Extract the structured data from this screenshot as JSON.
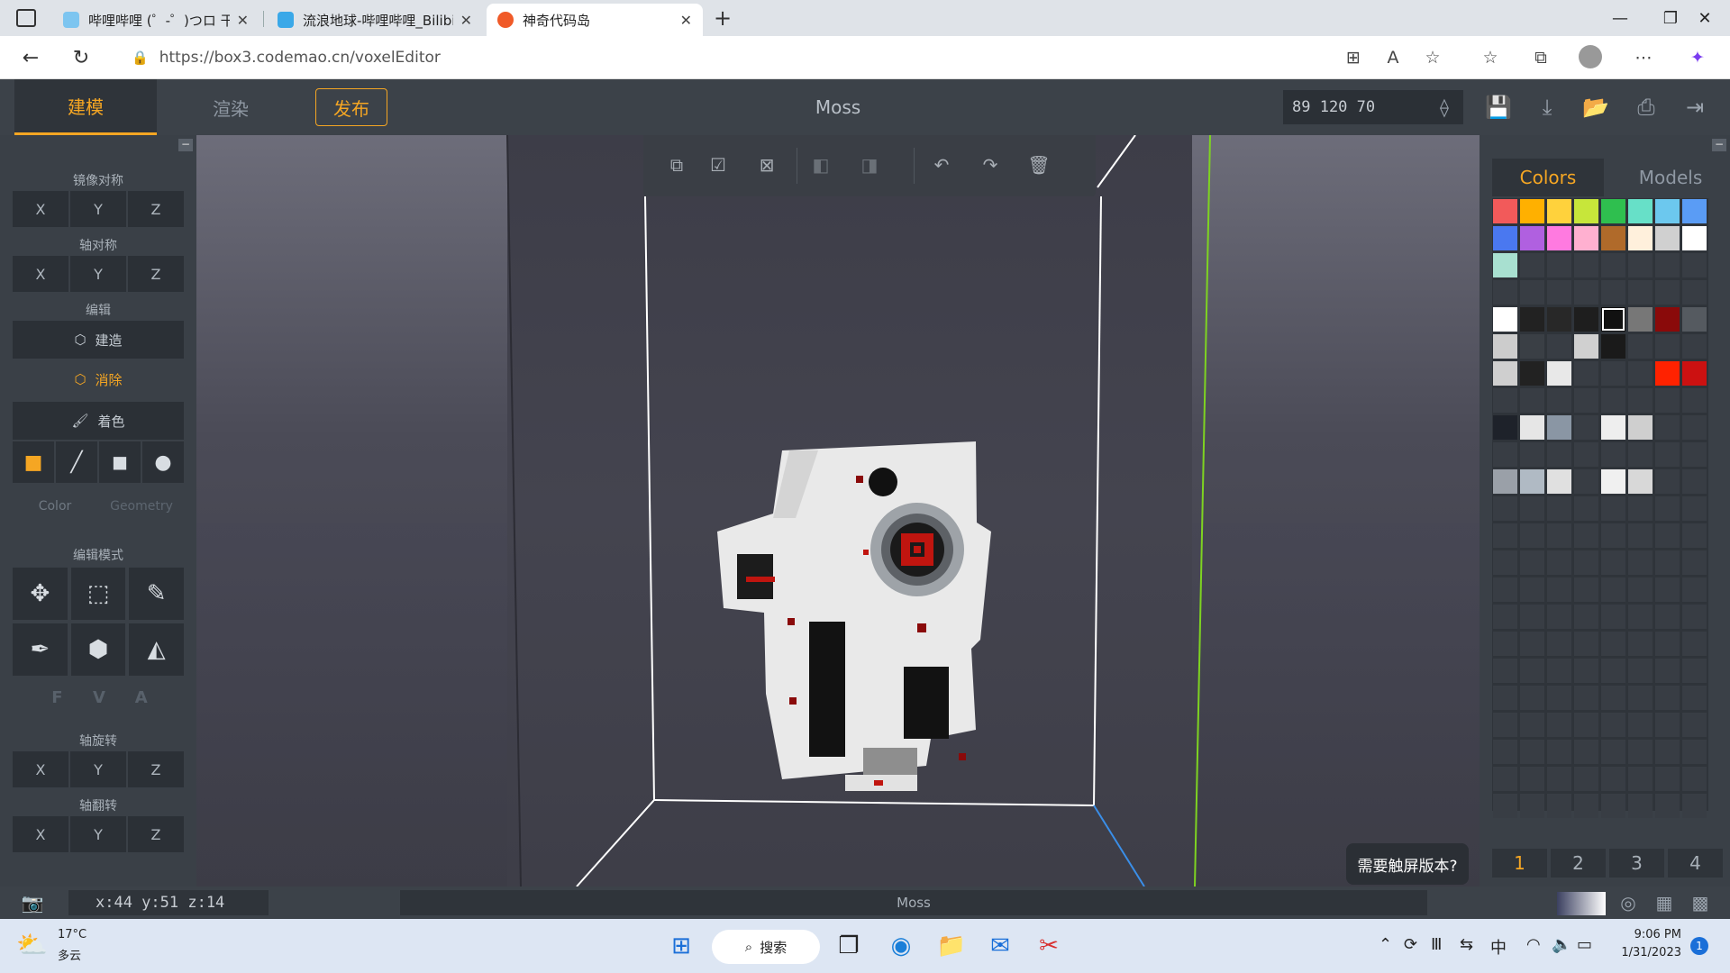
{
  "browser": {
    "tabs": [
      {
        "title": "哔哩哔哩 (゜-゜)つロ 干杯~-bilibili",
        "active": false
      },
      {
        "title": "流浪地球-哔哩哔哩_Bilibili",
        "active": false
      },
      {
        "title": "神奇代码岛",
        "active": true
      }
    ],
    "new_tab": "+",
    "url": "https://box3.codemao.cn/voxelEditor"
  },
  "app": {
    "tabs": {
      "build": "建模",
      "render": "渲染",
      "publish": "发布"
    },
    "project_name": "Moss",
    "coords": "89 120 70"
  },
  "left": {
    "mirror_title": "镜像对称",
    "axis_sym_title": "轴对称",
    "edit_title": "编辑",
    "build": "建造",
    "erase": "消除",
    "paint": "着色",
    "color_label": "Color",
    "geometry_label": "Geometry",
    "edit_mode_title": "编辑模式",
    "fva": [
      "F",
      "V",
      "A"
    ],
    "rotate_title": "轴旋转",
    "flip_title": "轴翻转",
    "x": "X",
    "y": "Y",
    "z": "Z"
  },
  "right": {
    "tab_colors": "Colors",
    "tab_models": "Models",
    "pages": [
      "1",
      "2",
      "3",
      "4"
    ],
    "swatches": [
      {
        "c": "#f25a5a",
        "r": 0,
        "k": 0
      },
      {
        "c": "#ffb000",
        "r": 0,
        "k": 1
      },
      {
        "c": "#ffd23c",
        "r": 0,
        "k": 2
      },
      {
        "c": "#c7e63a",
        "r": 0,
        "k": 3
      },
      {
        "c": "#2fbf4f",
        "r": 0,
        "k": 4
      },
      {
        "c": "#67e0c8",
        "r": 0,
        "k": 5
      },
      {
        "c": "#6cc8ee",
        "r": 0,
        "k": 6
      },
      {
        "c": "#5a9cf5",
        "r": 0,
        "k": 7
      },
      {
        "c": "#4a78f0",
        "r": 1,
        "k": 0
      },
      {
        "c": "#b060e0",
        "r": 1,
        "k": 1
      },
      {
        "c": "#ff7ae0",
        "r": 1,
        "k": 2
      },
      {
        "c": "#ffb0d0",
        "r": 1,
        "k": 3
      },
      {
        "c": "#b06a2a",
        "r": 1,
        "k": 4
      },
      {
        "c": "#fff0dc",
        "r": 1,
        "k": 5
      },
      {
        "c": "#d0d0d0",
        "r": 1,
        "k": 6
      },
      {
        "c": "#ffffff",
        "r": 1,
        "k": 7
      },
      {
        "c": "#a8e0d0",
        "r": 2,
        "k": 0
      },
      {
        "c": "#ffffff",
        "r": 4,
        "k": 0
      },
      {
        "c": "#222222",
        "r": 4,
        "k": 1
      },
      {
        "c": "#282828",
        "r": 4,
        "k": 2
      },
      {
        "c": "#1e1e1e",
        "r": 4,
        "k": 3
      },
      {
        "c": "#111111",
        "r": 4,
        "k": 4
      },
      {
        "c": "#777777",
        "r": 4,
        "k": 5
      },
      {
        "c": "#8a0a0a",
        "r": 4,
        "k": 6
      },
      {
        "c": "#555a60",
        "r": 4,
        "k": 7
      },
      {
        "c": "#cccccc",
        "r": 5,
        "k": 0
      },
      {
        "c": "#3a3f45",
        "r": 5,
        "k": 1
      },
      {
        "c": "#d0d0d0",
        "r": 5,
        "k": 3
      },
      {
        "c": "#1a1a1a",
        "r": 5,
        "k": 4
      },
      {
        "c": "#cfcfcf",
        "r": 6,
        "k": 0
      },
      {
        "c": "#222222",
        "r": 6,
        "k": 1
      },
      {
        "c": "#e8e8e8",
        "r": 6,
        "k": 2
      },
      {
        "c": "#ff2200",
        "r": 6,
        "k": 6
      },
      {
        "c": "#cc1111",
        "r": 6,
        "k": 7
      },
      {
        "c": "#1e222a",
        "r": 8,
        "k": 0
      },
      {
        "c": "#e6e6e6",
        "r": 8,
        "k": 1
      },
      {
        "c": "#8a96a4",
        "r": 8,
        "k": 2
      },
      {
        "c": "#eeeeee",
        "r": 8,
        "k": 4
      },
      {
        "c": "#cfcfcf",
        "r": 8,
        "k": 5
      },
      {
        "c": "#9aa0a8",
        "r": 10,
        "k": 0
      },
      {
        "c": "#b0bac4",
        "r": 10,
        "k": 1
      },
      {
        "c": "#e0e0e0",
        "r": 10,
        "k": 2
      },
      {
        "c": "#f0f0f0",
        "r": 10,
        "k": 4
      },
      {
        "c": "#d8d8d8",
        "r": 10,
        "k": 5
      }
    ],
    "selected_swatch": {
      "r": 4,
      "k": 4
    }
  },
  "viewport": {
    "touch_button": "需要触屏版本?"
  },
  "status": {
    "cursor": "x:44 y:51 z:14",
    "name": "Moss"
  },
  "taskbar": {
    "temp": "17°C",
    "weather": "多云",
    "search": "搜索",
    "ime": "中",
    "time": "9:06 PM",
    "date": "1/31/2023",
    "notif": "1"
  }
}
